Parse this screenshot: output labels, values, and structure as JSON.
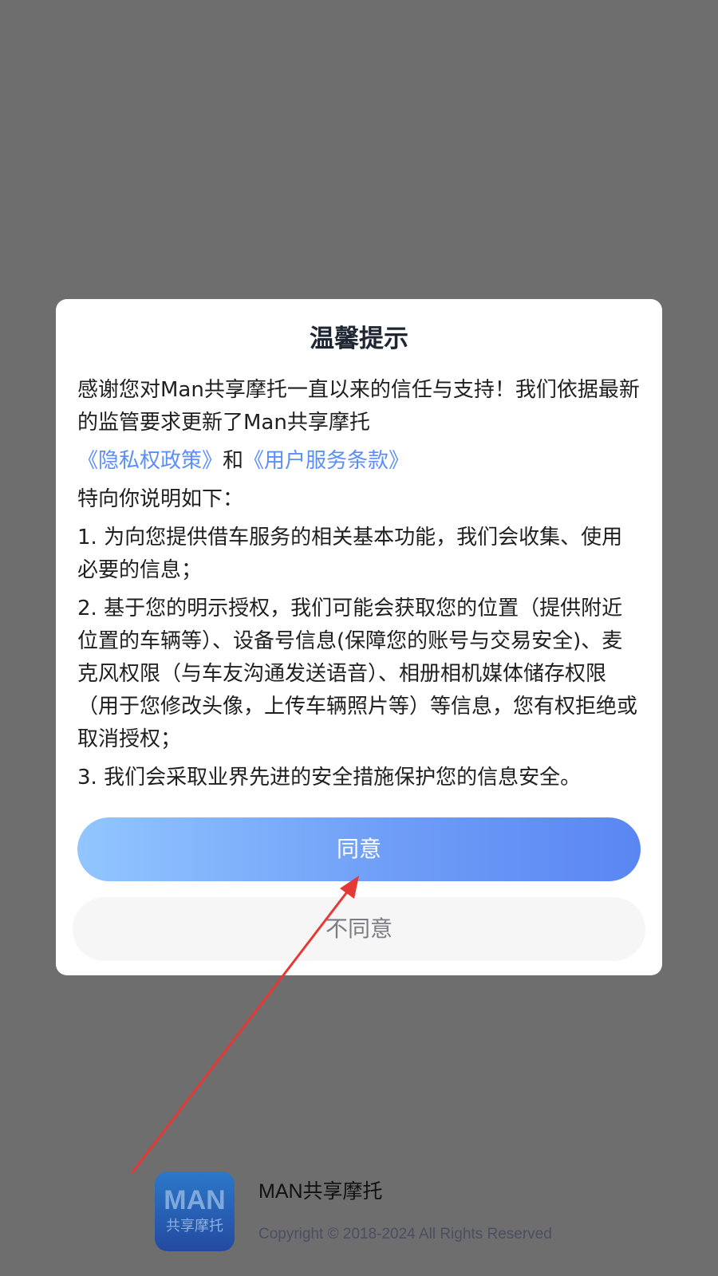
{
  "dialog": {
    "title": "温馨提示",
    "intro": "感谢您对Man共享摩托一直以来的信任与支持！我们依据最新的监管要求更新了Man共享摩托",
    "privacy_link": "《隐私权政策》",
    "and_text": "和",
    "service_link": "《用户服务条款》",
    "explain_heading": "特向你说明如下：",
    "items": [
      "1. 为向您提供借车服务的相关基本功能，我们会收集、使用必要的信息；",
      "2. 基于您的明示授权，我们可能会获取您的位置（提供附近位置的车辆等）、设备号信息(保障您的账号与交易安全)、麦克风权限（与车友沟通发送语音）、相册相机媒体储存权限（用于您修改头像，上传车辆照片等）等信息，您有权拒绝或取消授权；",
      "3. 我们会采取业界先进的安全措施保护您的信息安全。"
    ],
    "agree_label": "同意",
    "disagree_label": "不同意"
  },
  "footer": {
    "logo_text": "MAN",
    "logo_subtext": "共享摩托",
    "app_name": "MAN共享摩托",
    "copyright": "Copyright © 2018-2024 All Rights Reserved"
  },
  "colors": {
    "overlay": "#6e6e6e",
    "link": "#5b8ff7",
    "annotation_arrow": "#e53935"
  },
  "icons": {
    "annotation": "red-arrow-pointer"
  }
}
